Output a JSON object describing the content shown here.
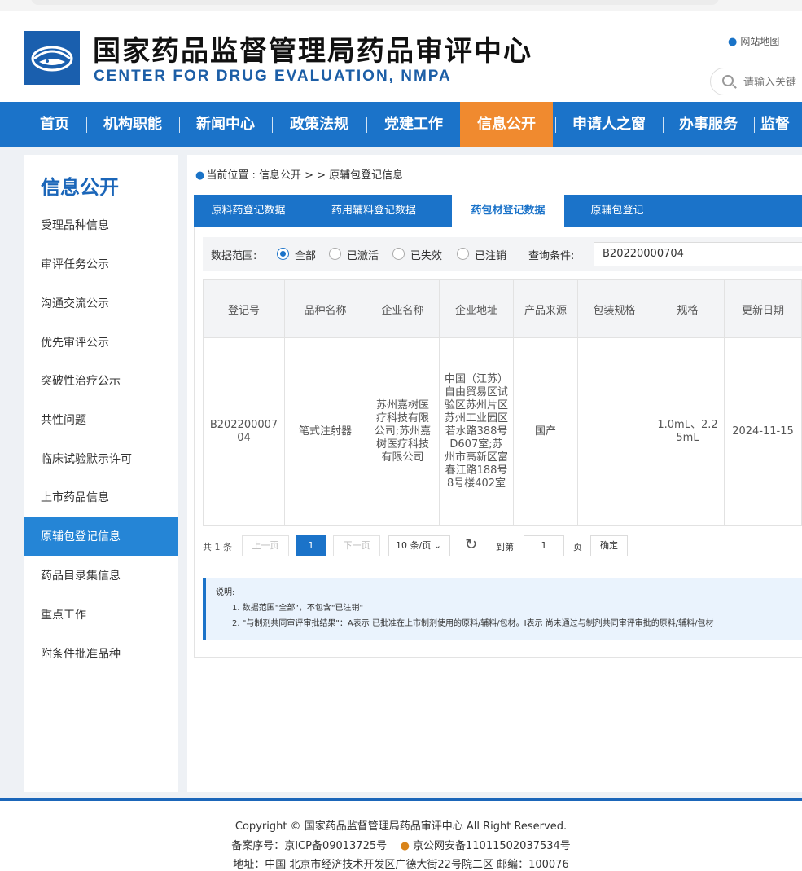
{
  "header": {
    "title_cn": "国家药品监督管理局药品审评中心",
    "title_en": "CENTER FOR DRUG EVALUATION, NMPA",
    "sitemap": "网站地图",
    "search_placeholder": "请输入关键"
  },
  "nav": {
    "items": [
      "首页",
      "机构职能",
      "新闻中心",
      "政策法规",
      "党建工作",
      "信息公开",
      "申请人之窗",
      "办事服务",
      "监督"
    ],
    "active": "信息公开"
  },
  "sidebar": {
    "title": "信息公开",
    "items": [
      "受理品种信息",
      "审评任务公示",
      "沟通交流公示",
      "优先审评公示",
      "突破性治疗公示",
      "共性问题",
      "临床试验默示许可",
      "上市药品信息",
      "原辅包登记信息",
      "药品目录集信息",
      "重点工作",
      "附条件批准品种"
    ],
    "active": "原辅包登记信息"
  },
  "breadcrumb": {
    "text": "当前位置 : 信息公开 > > 原辅包登记信息"
  },
  "tabs": {
    "items": [
      "原料药登记数据",
      "药用辅料登记数据",
      "药包材登记数据",
      "原辅包登记"
    ],
    "active": "药包材登记数据"
  },
  "filter": {
    "range_label": "数据范围:",
    "options": [
      "全部",
      "已激活",
      "已失效",
      "已注销"
    ],
    "selected": "全部",
    "query_label": "查询条件:",
    "query_value": "B20220000704"
  },
  "table": {
    "headers": [
      "登记号",
      "品种名称",
      "企业名称",
      "企业地址",
      "产品来源",
      "包装规格",
      "规格",
      "更新日期"
    ],
    "rows": [
      [
        "B20220000704",
        "笔式注射器",
        "苏州嘉树医疗科技有限公司;苏州嘉树医疗科技有限公司",
        "中国（江苏）自由贸易区试验区苏州片区苏州工业园区若水路388号D607室;苏州市高新区富春江路188号8号楼402室",
        "国产",
        "",
        "1.0mL、2.25mL",
        "2024-11-15"
      ]
    ]
  },
  "pager": {
    "total": "共 1 条",
    "prev": "上一页",
    "page": "1",
    "next": "下一页",
    "page_size": "10 条/页",
    "goto_label": "到第",
    "goto_value": "1",
    "page_word": "页",
    "confirm": "确定"
  },
  "note": {
    "title": "说明:",
    "line1": "1. 数据范围\"全部\"，不包含\"已注销\"",
    "line2": "2. \"与制剂共同审评审批结果\"：A表示 已批准在上市制剂使用的原料/辅料/包材。I表示 尚未通过与制剂共同审评审批的原料/辅料/包材"
  },
  "footer": {
    "copyright": "Copyright © 国家药品监督管理局药品审评中心   All Right Reserved.",
    "icp": "备案序号：京ICP备09013725号",
    "police": "京公网安备11011502037534号",
    "address": "地址：中国 北京市经济技术开发区广德大街22号院二区      邮编：100076"
  },
  "colors": {
    "brand_blue": "#1b73c9",
    "active_orange": "#f08a2f"
  }
}
